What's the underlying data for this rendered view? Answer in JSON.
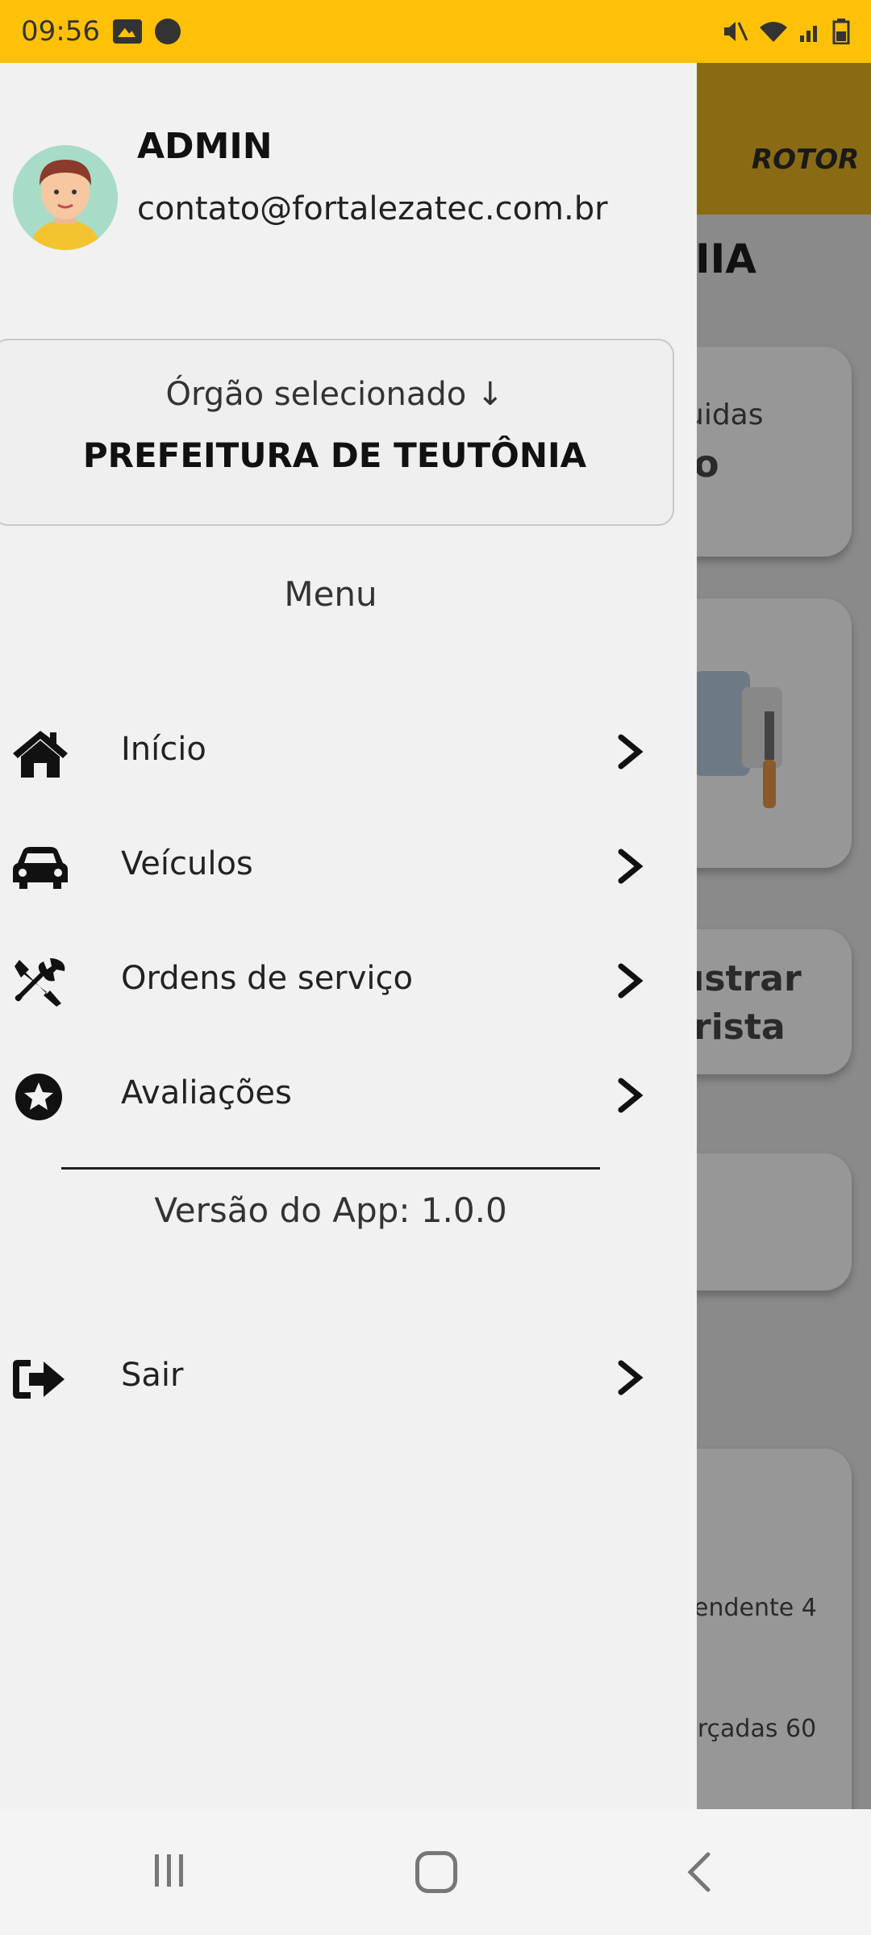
{
  "status_bar": {
    "time": "09:56"
  },
  "background_app": {
    "logo": "ROTOR",
    "title_fragment": "IIA",
    "card1_text_a": "uidas",
    "card1_text_b": "o",
    "card3_line1": "ustrar",
    "card3_line2": "rista",
    "pending_text": "endente 4",
    "forced_text": "Irçadas 60"
  },
  "drawer": {
    "user": {
      "name": "ADMIN",
      "email": "contato@fortalezatec.com.br"
    },
    "org": {
      "label": "Órgão selecionado ↓",
      "name": "PREFEITURA DE TEUTÔNIA"
    },
    "menu_title": "Menu",
    "items": [
      {
        "label": "Início",
        "icon": "home-icon"
      },
      {
        "label": "Veículos",
        "icon": "car-icon"
      },
      {
        "label": "Ordens de serviço",
        "icon": "tools-icon"
      },
      {
        "label": "Avaliações",
        "icon": "star-circle-icon"
      }
    ],
    "version": "Versão do App: 1.0.0",
    "logout": {
      "label": "Sair",
      "icon": "logout-icon"
    }
  },
  "colors": {
    "status_bar": "#ffc107",
    "drawer_bg": "#f1f1f1",
    "scrim": "#8a8a8a"
  }
}
